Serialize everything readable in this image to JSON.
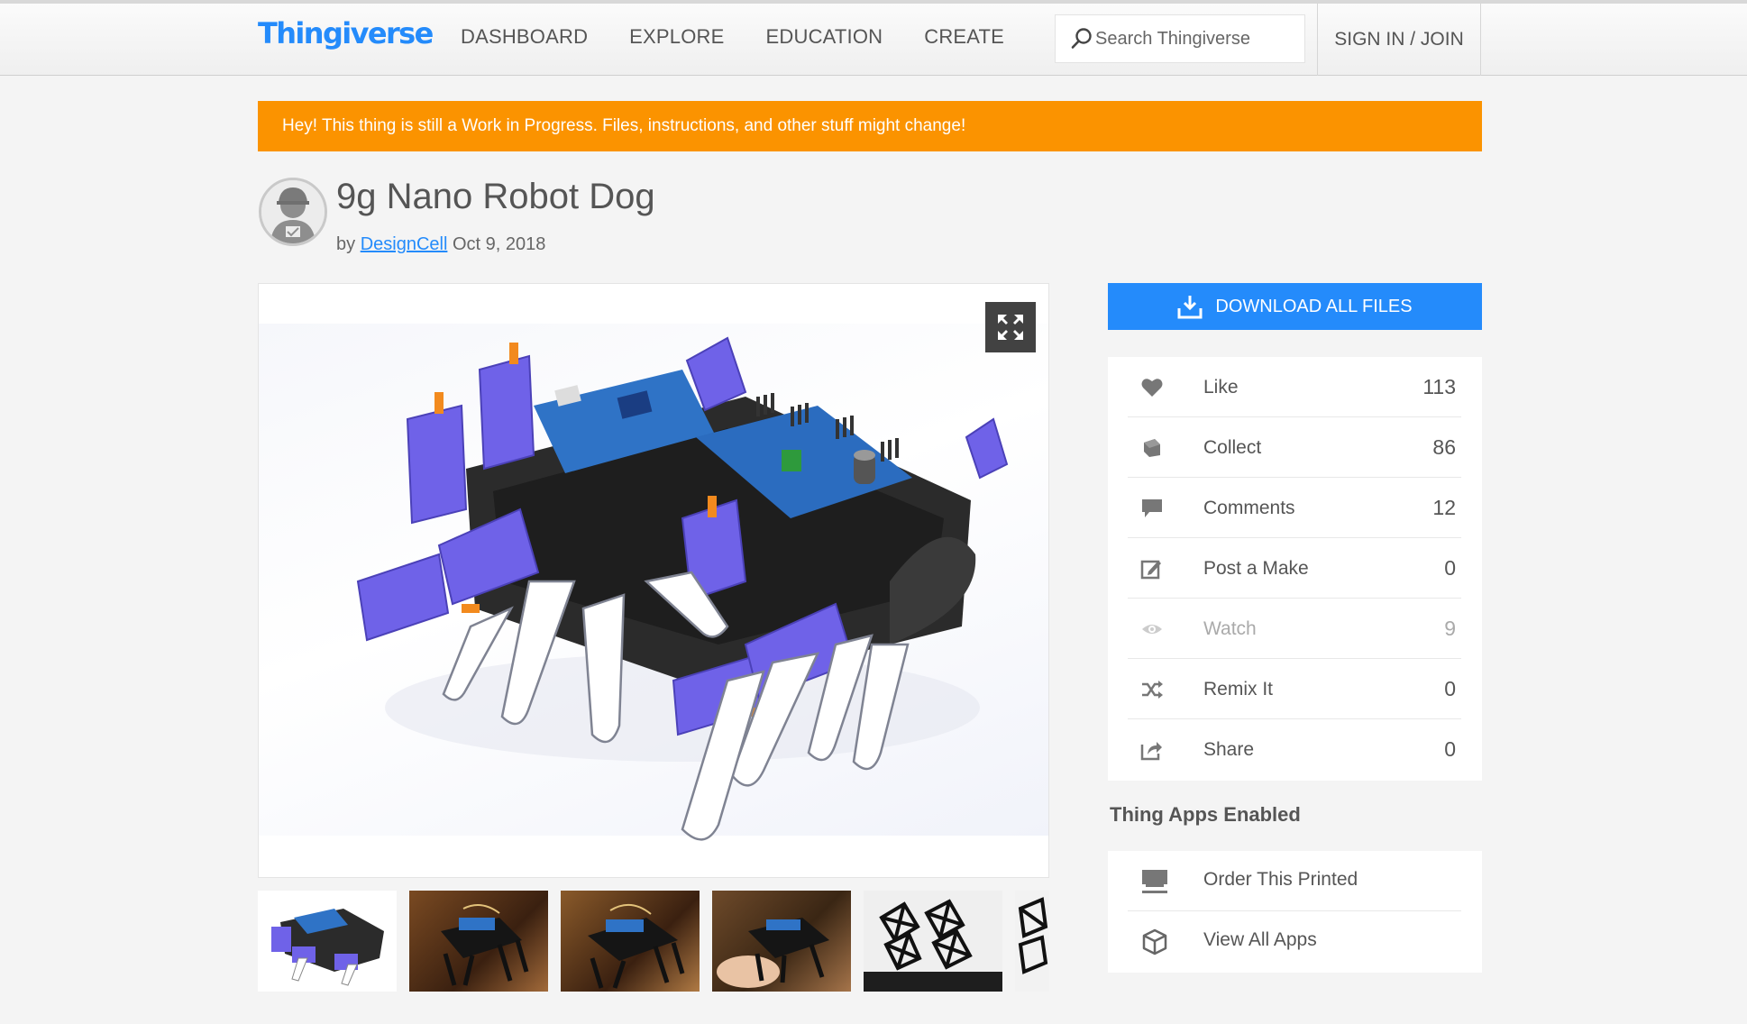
{
  "header": {
    "logo": "Thingiverse",
    "nav": [
      "DASHBOARD",
      "EXPLORE",
      "EDUCATION",
      "CREATE"
    ],
    "search_placeholder": "Search Thingiverse",
    "signin": "SIGN IN / JOIN"
  },
  "banner": "Hey! This thing is still a Work in Progress. Files, instructions, and other stuff might change!",
  "thing": {
    "title": "9g Nano Robot Dog",
    "by": "by",
    "author": "DesignCell",
    "date": "Oct 9, 2018"
  },
  "sidebar": {
    "download_label": "DOWNLOAD ALL FILES",
    "stats": [
      {
        "icon": "heart-icon",
        "label": "Like",
        "count": "113"
      },
      {
        "icon": "collect-icon",
        "label": "Collect",
        "count": "86"
      },
      {
        "icon": "comment-icon",
        "label": "Comments",
        "count": "12"
      },
      {
        "icon": "edit-icon",
        "label": "Post a Make",
        "count": "0"
      },
      {
        "icon": "eye-icon",
        "label": "Watch",
        "count": "9"
      },
      {
        "icon": "shuffle-icon",
        "label": "Remix It",
        "count": "0"
      },
      {
        "icon": "share-icon",
        "label": "Share",
        "count": "0"
      }
    ],
    "apps_title": "Thing Apps Enabled",
    "apps": [
      {
        "icon": "printer-icon",
        "label": "Order This Printed"
      },
      {
        "icon": "cube-icon",
        "label": "View All Apps"
      }
    ]
  },
  "colors": {
    "brand": "#248bfb",
    "banner": "#fb9300",
    "servo": "#6f62e8",
    "board": "#2f73c6"
  }
}
